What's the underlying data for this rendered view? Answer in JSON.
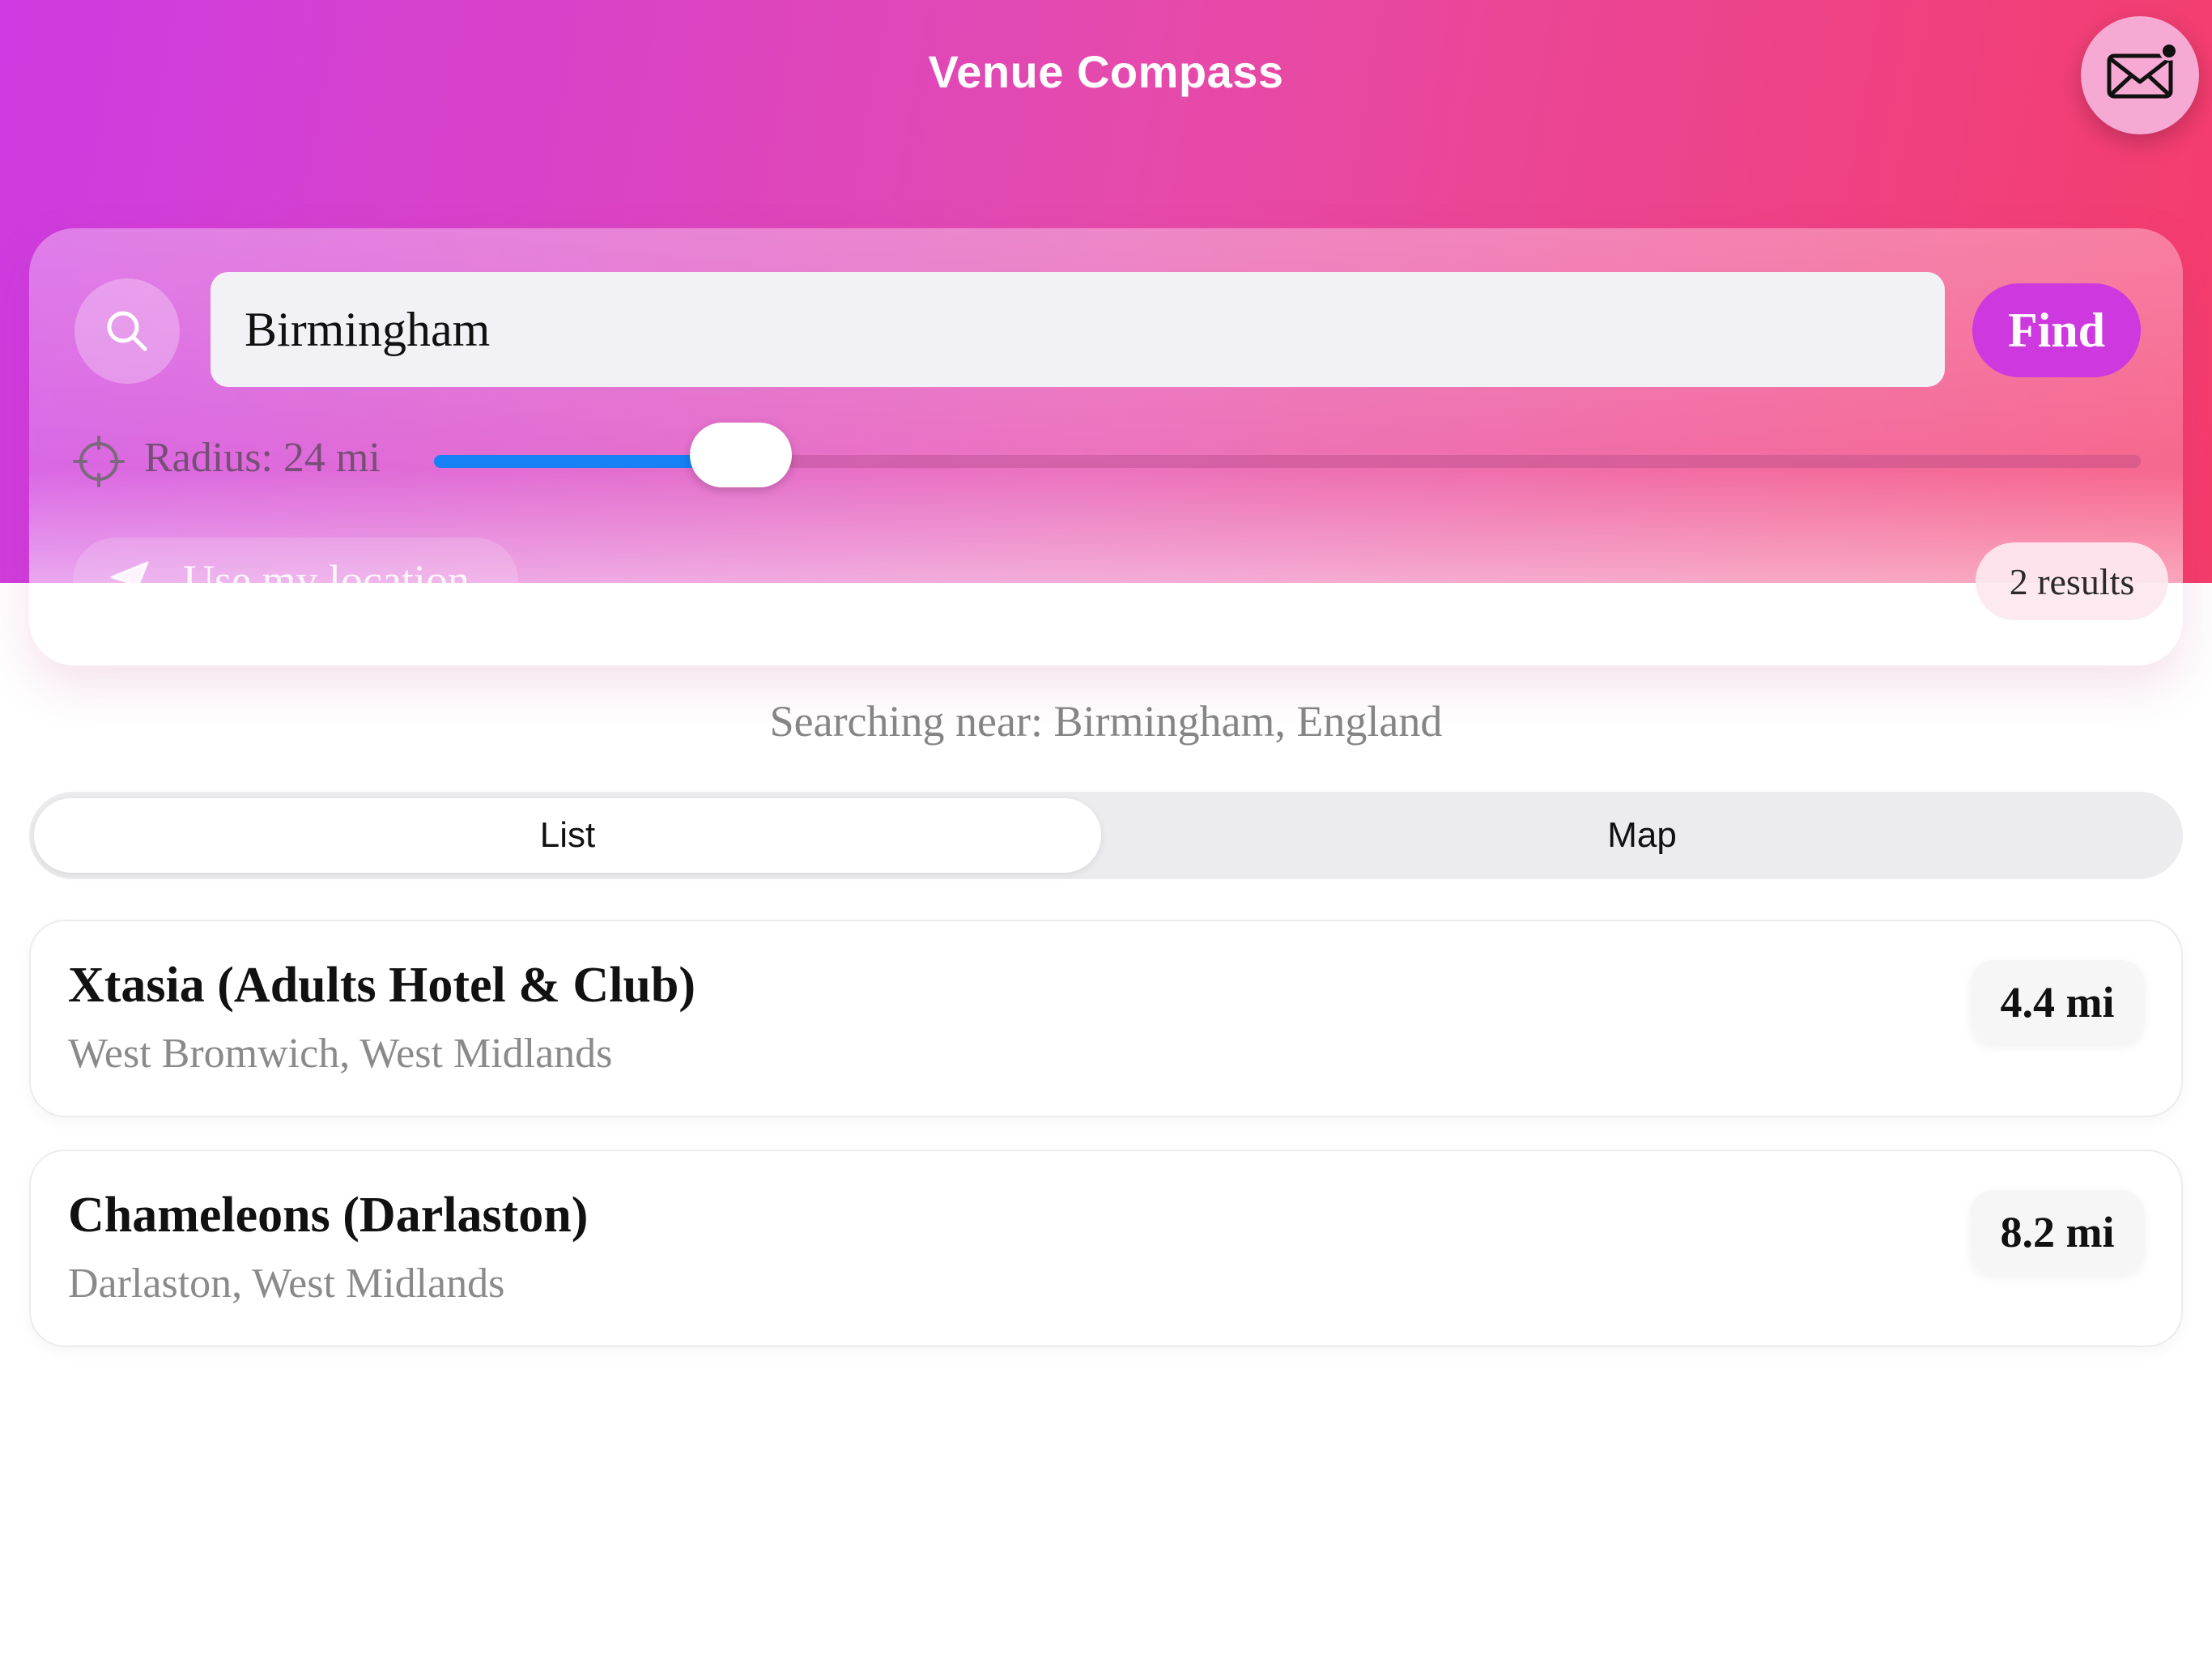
{
  "header": {
    "title": "Venue Compass",
    "mail_icon": "envelope-icon",
    "gradient_colors": [
      "#cd3be2",
      "#e54aac",
      "#f53c6a"
    ]
  },
  "search": {
    "icon": "search-icon",
    "value": "Birmingham",
    "find_label": "Find",
    "accent_color": "#cd38df"
  },
  "radius": {
    "icon": "crosshair-icon",
    "label": "Radius: 24 mi",
    "value_fraction": 0.18,
    "slider_color": "#1581f5"
  },
  "location": {
    "icon": "location-arrow-icon",
    "label": "Use my location"
  },
  "results": {
    "count_label": "2 results"
  },
  "searching_near": "Searching near: Birmingham, England",
  "view_toggle": {
    "list_label": "List",
    "map_label": "Map",
    "selected": "List"
  },
  "venues": [
    {
      "name": "Xtasia (Adults Hotel & Club)",
      "location": "West Bromwich, West Midlands",
      "distance": "4.4 mi"
    },
    {
      "name": "Chameleons (Darlaston)",
      "location": "Darlaston, West Midlands",
      "distance": "8.2 mi"
    }
  ]
}
